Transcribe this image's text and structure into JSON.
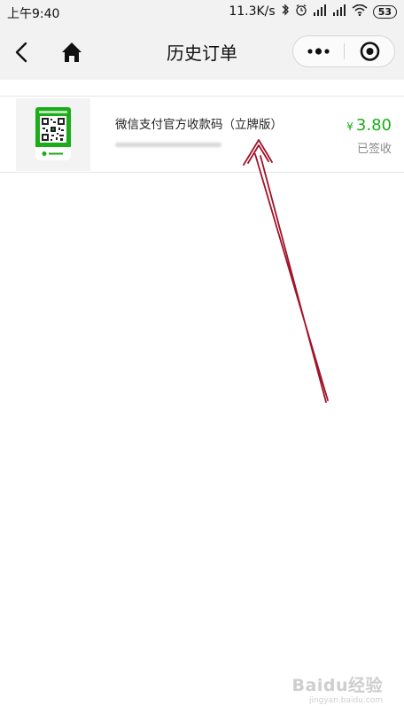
{
  "status_bar": {
    "time": "上午9:40",
    "net_speed": "11.3K/s",
    "battery": "53"
  },
  "navbar": {
    "title": "历史订单",
    "back_icon": "back-chevron-icon",
    "home_icon": "home-icon",
    "more_icon": "more-dots-icon",
    "close_icon": "close-circle-icon"
  },
  "orders": [
    {
      "title": "微信支付官方收款码（立牌版）",
      "currency": "¥",
      "price": "3.80",
      "status": "已签收",
      "price_color": "#1aad19"
    }
  ],
  "watermark": {
    "logo": "Baidu经验",
    "url": "jingyan.baidu.com"
  },
  "colors": {
    "accent": "#1aad19",
    "annotation_arrow": "#a0142a"
  }
}
